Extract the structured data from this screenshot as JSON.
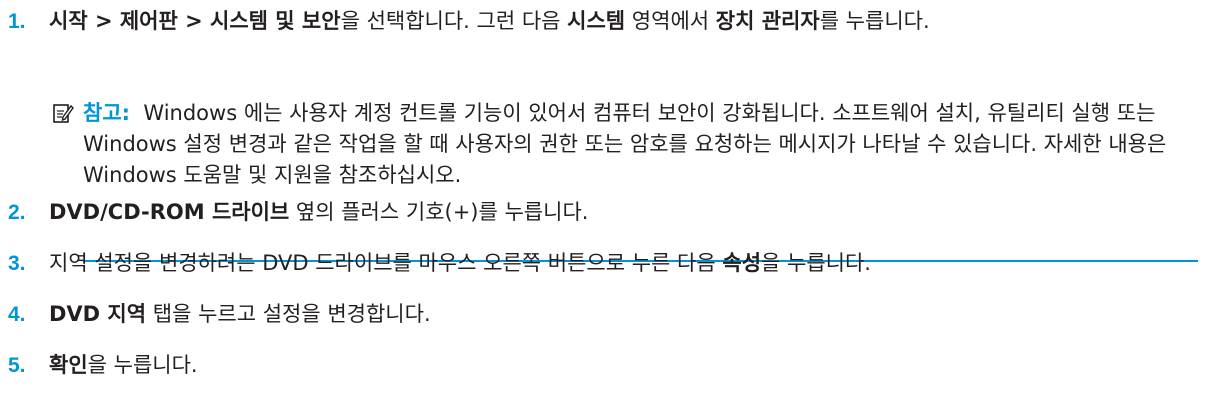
{
  "steps": [
    {
      "number": "1.",
      "parts": [
        {
          "t": "시작 > 제어판 > 시스템 및 보안",
          "b": true
        },
        {
          "t": "을 선택합니다. 그런 다음 ",
          "b": false
        },
        {
          "t": "시스템",
          "b": true
        },
        {
          "t": " 영역에서 ",
          "b": false
        },
        {
          "t": "장치 관리자",
          "b": true
        },
        {
          "t": "를 누릅니다.",
          "b": false
        }
      ]
    },
    {
      "number": "2.",
      "parts": [
        {
          "t": "DVD/CD-ROM 드라이브",
          "b": true
        },
        {
          "t": " 옆의 플러스 기호(+)를 누릅니다.",
          "b": false
        }
      ]
    },
    {
      "number": "3.",
      "parts": [
        {
          "t": "지역 설정을 변경하려는 DVD 드라이브를 마우스 오른쪽 버튼으로 누른 다음 ",
          "b": false
        },
        {
          "t": "속성",
          "b": true
        },
        {
          "t": "을 누릅니다.",
          "b": false
        }
      ]
    },
    {
      "number": "4.",
      "parts": [
        {
          "t": "DVD 지역",
          "b": true
        },
        {
          "t": " 탭을 누르고 설정을 변경합니다.",
          "b": false
        }
      ]
    },
    {
      "number": "5.",
      "parts": [
        {
          "t": "확인",
          "b": true
        },
        {
          "t": "을 누릅니다.",
          "b": false
        }
      ]
    }
  ],
  "note": {
    "icon": "note-pencil-icon",
    "label": "참고:",
    "body": "Windows 에는 사용자 계정 컨트롤 기능이 있어서 컴퓨터 보안이 강화됩니다. 소프트웨어 설치, 유틸리티 실행 또는 Windows 설정 변경과 같은 작업을 할 때 사용자의 권한 또는 암호를 요청하는 메시지가 나타날 수 있습니다. 자세한 내용은 Windows 도움말 및 지원을 참조하십시오."
  },
  "colors": {
    "accent": "#0096d6",
    "text": "#231f20"
  }
}
